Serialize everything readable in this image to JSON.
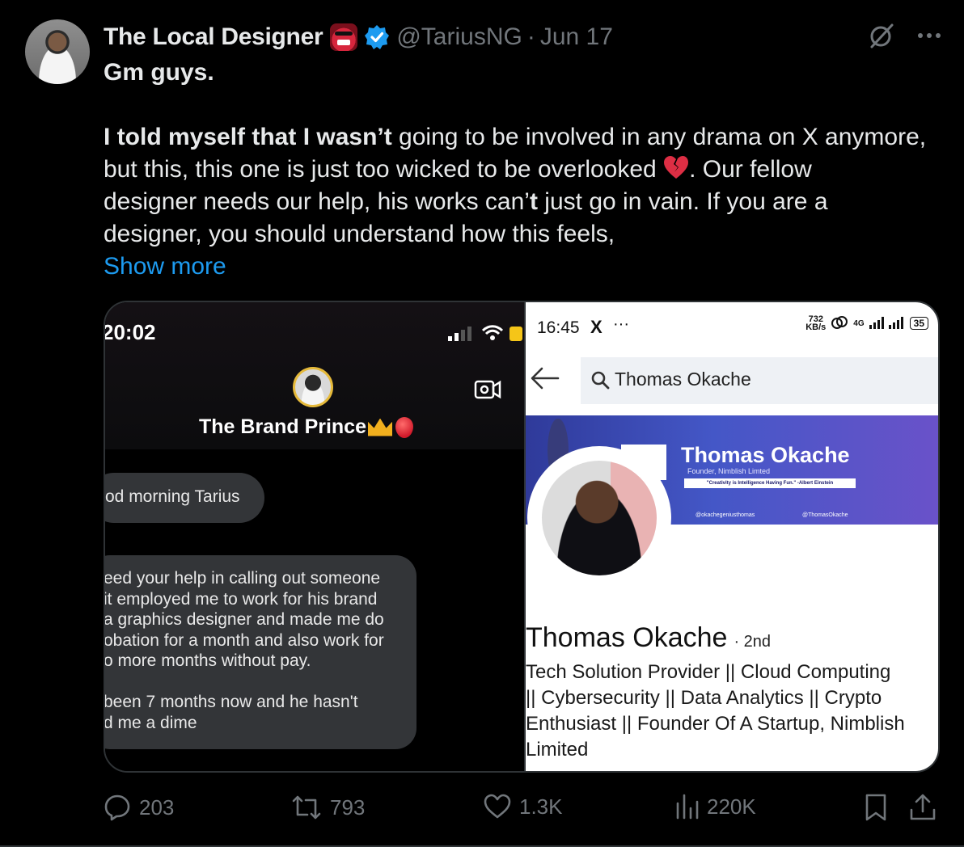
{
  "tweet": {
    "author_name": "The Local Designer",
    "handle": "@TariusNG",
    "separator": "·",
    "date": "Jun 17",
    "text_lines": {
      "l1": "Gm guys.",
      "l2_bold": "I told myself that I wasn’t",
      "l2_rest": " going to be involved in any drama on X anymore,",
      "l3a": "but this, this one is just too wicked to be overlooked ",
      "l3b": ". Our fellow",
      "l4a": "designer needs our help, his works can’",
      "l4b": "t",
      "l4c": " just go in vain. If you are a",
      "l5": "designer, you should understand how this feels,"
    },
    "show_more": "Show more"
  },
  "media": {
    "left": {
      "status_time": "20:02",
      "contact_name": "The Brand Prince",
      "message_1": "od morning Tarius",
      "message_2_lines": {
        "a": "eed your help in calling out someone",
        "b": "it employed me to work for his brand",
        "c": "a graphics designer and made me do",
        "d": "obation for a month and also work for",
        "e": "o more months without pay.",
        "f": "been 7 months now and he hasn't",
        "g": "d me a dime"
      }
    },
    "right": {
      "status_time": "16:45",
      "status_app": "X",
      "status_more": "···",
      "net_speed": "732",
      "net_unit": "KB/s",
      "net_type": "4G",
      "battery": "35",
      "search_query": "Thomas Okache",
      "banner_title": "Thomas Okache",
      "banner_subtitle": "Founder, Nimblish Limted",
      "banner_quote": "\"Creativity is Intelligence Having Fun.\" -Albert Einstein",
      "banner_handle_1": "@okachegeniusthomas",
      "banner_handle_2": "@ThomasOkache",
      "profile_name": "Thomas Okache",
      "connection": "· 2nd",
      "headline_lines": {
        "a": "Tech Solution Provider || Cloud Computing",
        "b": "|| Cybersecurity || Data Analytics || Crypto",
        "c": "Enthusiast || Founder Of A Startup, Nimblish",
        "d": "Limited"
      }
    }
  },
  "actions": {
    "replies": "203",
    "reposts": "793",
    "likes": "1.3K",
    "views": "220K"
  },
  "colors": {
    "background": "#000000",
    "text": "#e7e9ea",
    "muted": "#71767b",
    "link": "#1d9bf0",
    "verified": "#1d9bf0"
  }
}
